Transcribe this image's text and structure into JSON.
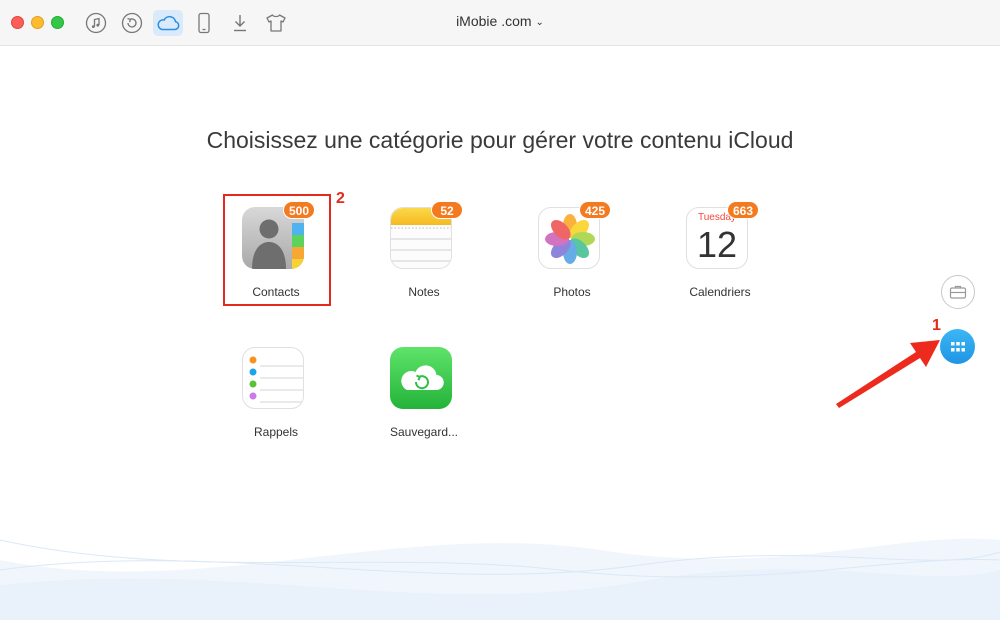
{
  "window": {
    "device_name": "iMobie .com"
  },
  "toolbar": {
    "items": [
      {
        "icon": "music-note-icon"
      },
      {
        "icon": "restore-icon"
      },
      {
        "icon": "icloud-icon",
        "active": true
      },
      {
        "icon": "phone-icon"
      },
      {
        "icon": "download-icon"
      },
      {
        "icon": "tshirt-icon"
      }
    ]
  },
  "main": {
    "heading": "Choisissez une catégorie pour gérer votre contenu iCloud",
    "categories": [
      {
        "label": "Contacts",
        "badge": "500",
        "icon": "contacts-icon"
      },
      {
        "label": "Notes",
        "badge": "52",
        "icon": "notes-icon"
      },
      {
        "label": "Photos",
        "badge": "425",
        "icon": "photos-icon"
      },
      {
        "label": "Calendriers",
        "badge": "663",
        "icon": "calendar-icon",
        "calendar_day": "Tuesday",
        "calendar_date": "12"
      },
      {
        "label": "Rappels",
        "icon": "reminders-icon"
      },
      {
        "label": "Sauvegard...",
        "icon": "icloud-backup-icon"
      }
    ]
  },
  "annotations": {
    "step1": "1",
    "step2": "2",
    "color": "#e42a1d"
  },
  "colors": {
    "badge": "#f47a20",
    "accent": "#1f95e4"
  }
}
